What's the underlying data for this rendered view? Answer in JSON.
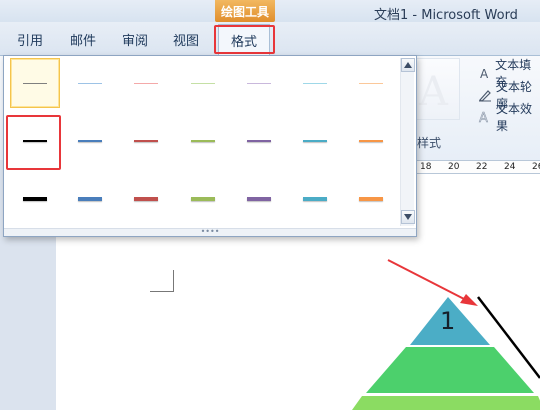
{
  "window": {
    "title": "文档1 - Microsoft Word",
    "context_tab": "绘图工具"
  },
  "tabs": [
    {
      "label": "引用"
    },
    {
      "label": "邮件"
    },
    {
      "label": "审阅"
    },
    {
      "label": "视图"
    },
    {
      "label": "格式",
      "active": true
    }
  ],
  "ribbon": {
    "wordart_glyph": "A",
    "side_items": [
      {
        "label": "文本填充",
        "icon": "text-fill-icon"
      },
      {
        "label": "文本轮廓",
        "icon": "text-outline-icon"
      },
      {
        "label": "文本效果",
        "icon": "text-effects-icon"
      }
    ],
    "group_label": "样式",
    "ruler_ticks": [
      "18",
      "20",
      "22",
      "24",
      "26"
    ]
  },
  "gallery": {
    "rows": [
      [
        "#7f7f7f",
        "#9dc3e6",
        "#f4a9a9",
        "#c5e0a5",
        "#c9b8dc",
        "#9fd8e8",
        "#fbc89a"
      ],
      [
        "#000000",
        "#4a7ebb",
        "#c0504d",
        "#9bbb59",
        "#8064a2",
        "#4bacc6",
        "#f79646"
      ],
      [
        "#000000",
        "#4a7ebb",
        "#c0504d",
        "#9bbb59",
        "#8064a2",
        "#4bacc6",
        "#f79646"
      ]
    ],
    "selected_cell": "row1-col1",
    "highlighted_cell": "row2-col1",
    "grip": "••••"
  },
  "diagram": {
    "pyramid_label": "1",
    "colors": {
      "top": "#4badc6",
      "middle": "#4cd06c",
      "bottom": "#8bdc62",
      "arrow": "#e8363a"
    }
  }
}
